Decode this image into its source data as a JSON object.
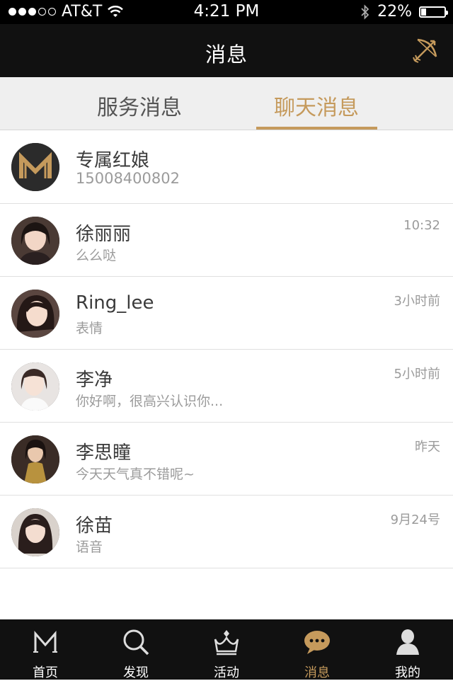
{
  "status_bar": {
    "carrier": "AT&T",
    "time": "4:21 PM",
    "battery": "22%",
    "battery_level": 0.22
  },
  "nav": {
    "title": "消息",
    "action_icon": "cupid-bow-icon"
  },
  "segments": {
    "service_label": "服务消息",
    "chat_label": "聊天消息",
    "selected": "chat"
  },
  "colors": {
    "accent": "#c59a5c",
    "bar_bg": "#111111"
  },
  "conversations": [
    {
      "name": "专属红娘",
      "preview": "15008400802",
      "time": ""
    },
    {
      "name": "徐丽丽",
      "preview": "么么哒",
      "time": "10:32"
    },
    {
      "name": "Ring_lee",
      "preview": "表情",
      "time": "3小时前"
    },
    {
      "name": "李净",
      "preview": "你好啊，很高兴认识你...",
      "time": "5小时前"
    },
    {
      "name": "李思瞳",
      "preview": "今天天气真不错呢~",
      "time": "昨天"
    },
    {
      "name": "徐苗",
      "preview": "语音",
      "time": "9月24号"
    }
  ],
  "tabbar": {
    "items": [
      {
        "label": "首页",
        "icon": "m-logo-icon"
      },
      {
        "label": "发现",
        "icon": "search-icon"
      },
      {
        "label": "活动",
        "icon": "crown-icon"
      },
      {
        "label": "消息",
        "icon": "chat-bubble-icon"
      },
      {
        "label": "我的",
        "icon": "person-icon"
      }
    ],
    "active_index": 3
  }
}
